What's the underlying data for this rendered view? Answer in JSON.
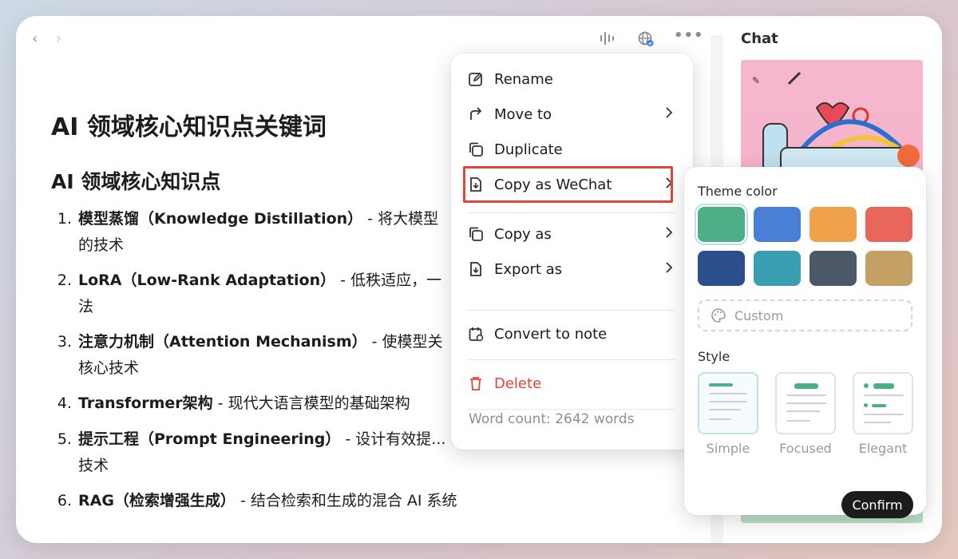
{
  "window": {
    "chat_label": "Chat"
  },
  "document": {
    "title": "AI 领域核心知识点关键词",
    "heading": "AI 领域核心知识点",
    "items": [
      {
        "num": "1.",
        "term": "模型蒸馏（Knowledge Distillation）",
        "desc": " - 将大模型",
        "cont": "的技术"
      },
      {
        "num": "2.",
        "term": "LoRA（Low-Rank Adaptation）",
        "desc": " - 低秩适应，一",
        "cont": "法"
      },
      {
        "num": "3.",
        "term": "注意力机制（Attention Mechanism）",
        "desc": " - 使模型关",
        "cont": "核心技术"
      },
      {
        "num": "4.",
        "term": "Transformer架构",
        "desc": " - 现代大语言模型的基础架构",
        "cont": ""
      },
      {
        "num": "5.",
        "term": "提示工程（Prompt Engineering）",
        "desc": " - 设计有效提...",
        "cont": "技术"
      },
      {
        "num": "6.",
        "term": "RAG（检索增强生成）",
        "desc": " - 结合检索和生成的混合 AI 系统",
        "cont": ""
      }
    ]
  },
  "menu": {
    "rename": "Rename",
    "move_to": "Move to",
    "duplicate": "Duplicate",
    "copy_as_wechat": "Copy as WeChat",
    "copy_as": "Copy as",
    "export_as": "Export as",
    "convert_to_note": "Convert to note",
    "delete": "Delete",
    "word_count": "Word count: 2642 words",
    "delete_color": "#e0463a"
  },
  "wechat_panel": {
    "theme_color_label": "Theme color",
    "colors": [
      "#4caf86",
      "#4a7fd6",
      "#f0a24a",
      "#e8675a",
      "#2a4f8c",
      "#3a9eb2",
      "#4c5767",
      "#c4a064"
    ],
    "selected_color": "#4caf86",
    "custom_label": "Custom",
    "style_label": "Style",
    "styles": [
      "Simple",
      "Focused",
      "Elegant"
    ],
    "selected_style": "Simple",
    "confirm_label": "Confirm"
  }
}
